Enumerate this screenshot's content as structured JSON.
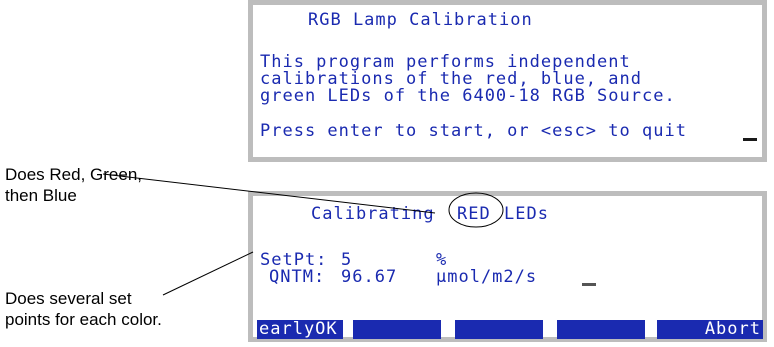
{
  "colors": {
    "screen_text": "#1a2ab0",
    "frame": "#bdbdbd",
    "key_bg": "#1a2ab0",
    "key_text": "#ffffff"
  },
  "screen1": {
    "title": "RGB Lamp Calibration",
    "body_lines": [
      "This program performs independent",
      "calibrations of the red, blue, and",
      "green LEDs of the 6400-18 RGB Source."
    ],
    "prompt": "Press enter to start, or <esc> to quit"
  },
  "screen2": {
    "title_prefix": "Calibrating",
    "title_color": "RED",
    "title_suffix": "LEDs",
    "setpt_label": "SetPt:",
    "setpt_value": "5",
    "setpt_unit": "%",
    "qntm_label": "QNTM:",
    "qntm_value": "96.67",
    "qntm_unit": "µmol/m2/s",
    "function_keys": [
      "earlyOK",
      "",
      "",
      "",
      "Abort"
    ]
  },
  "annotations": {
    "color_order": "Does Red, Green,\nthen Blue",
    "set_points": "Does several set\npoints for each color."
  }
}
